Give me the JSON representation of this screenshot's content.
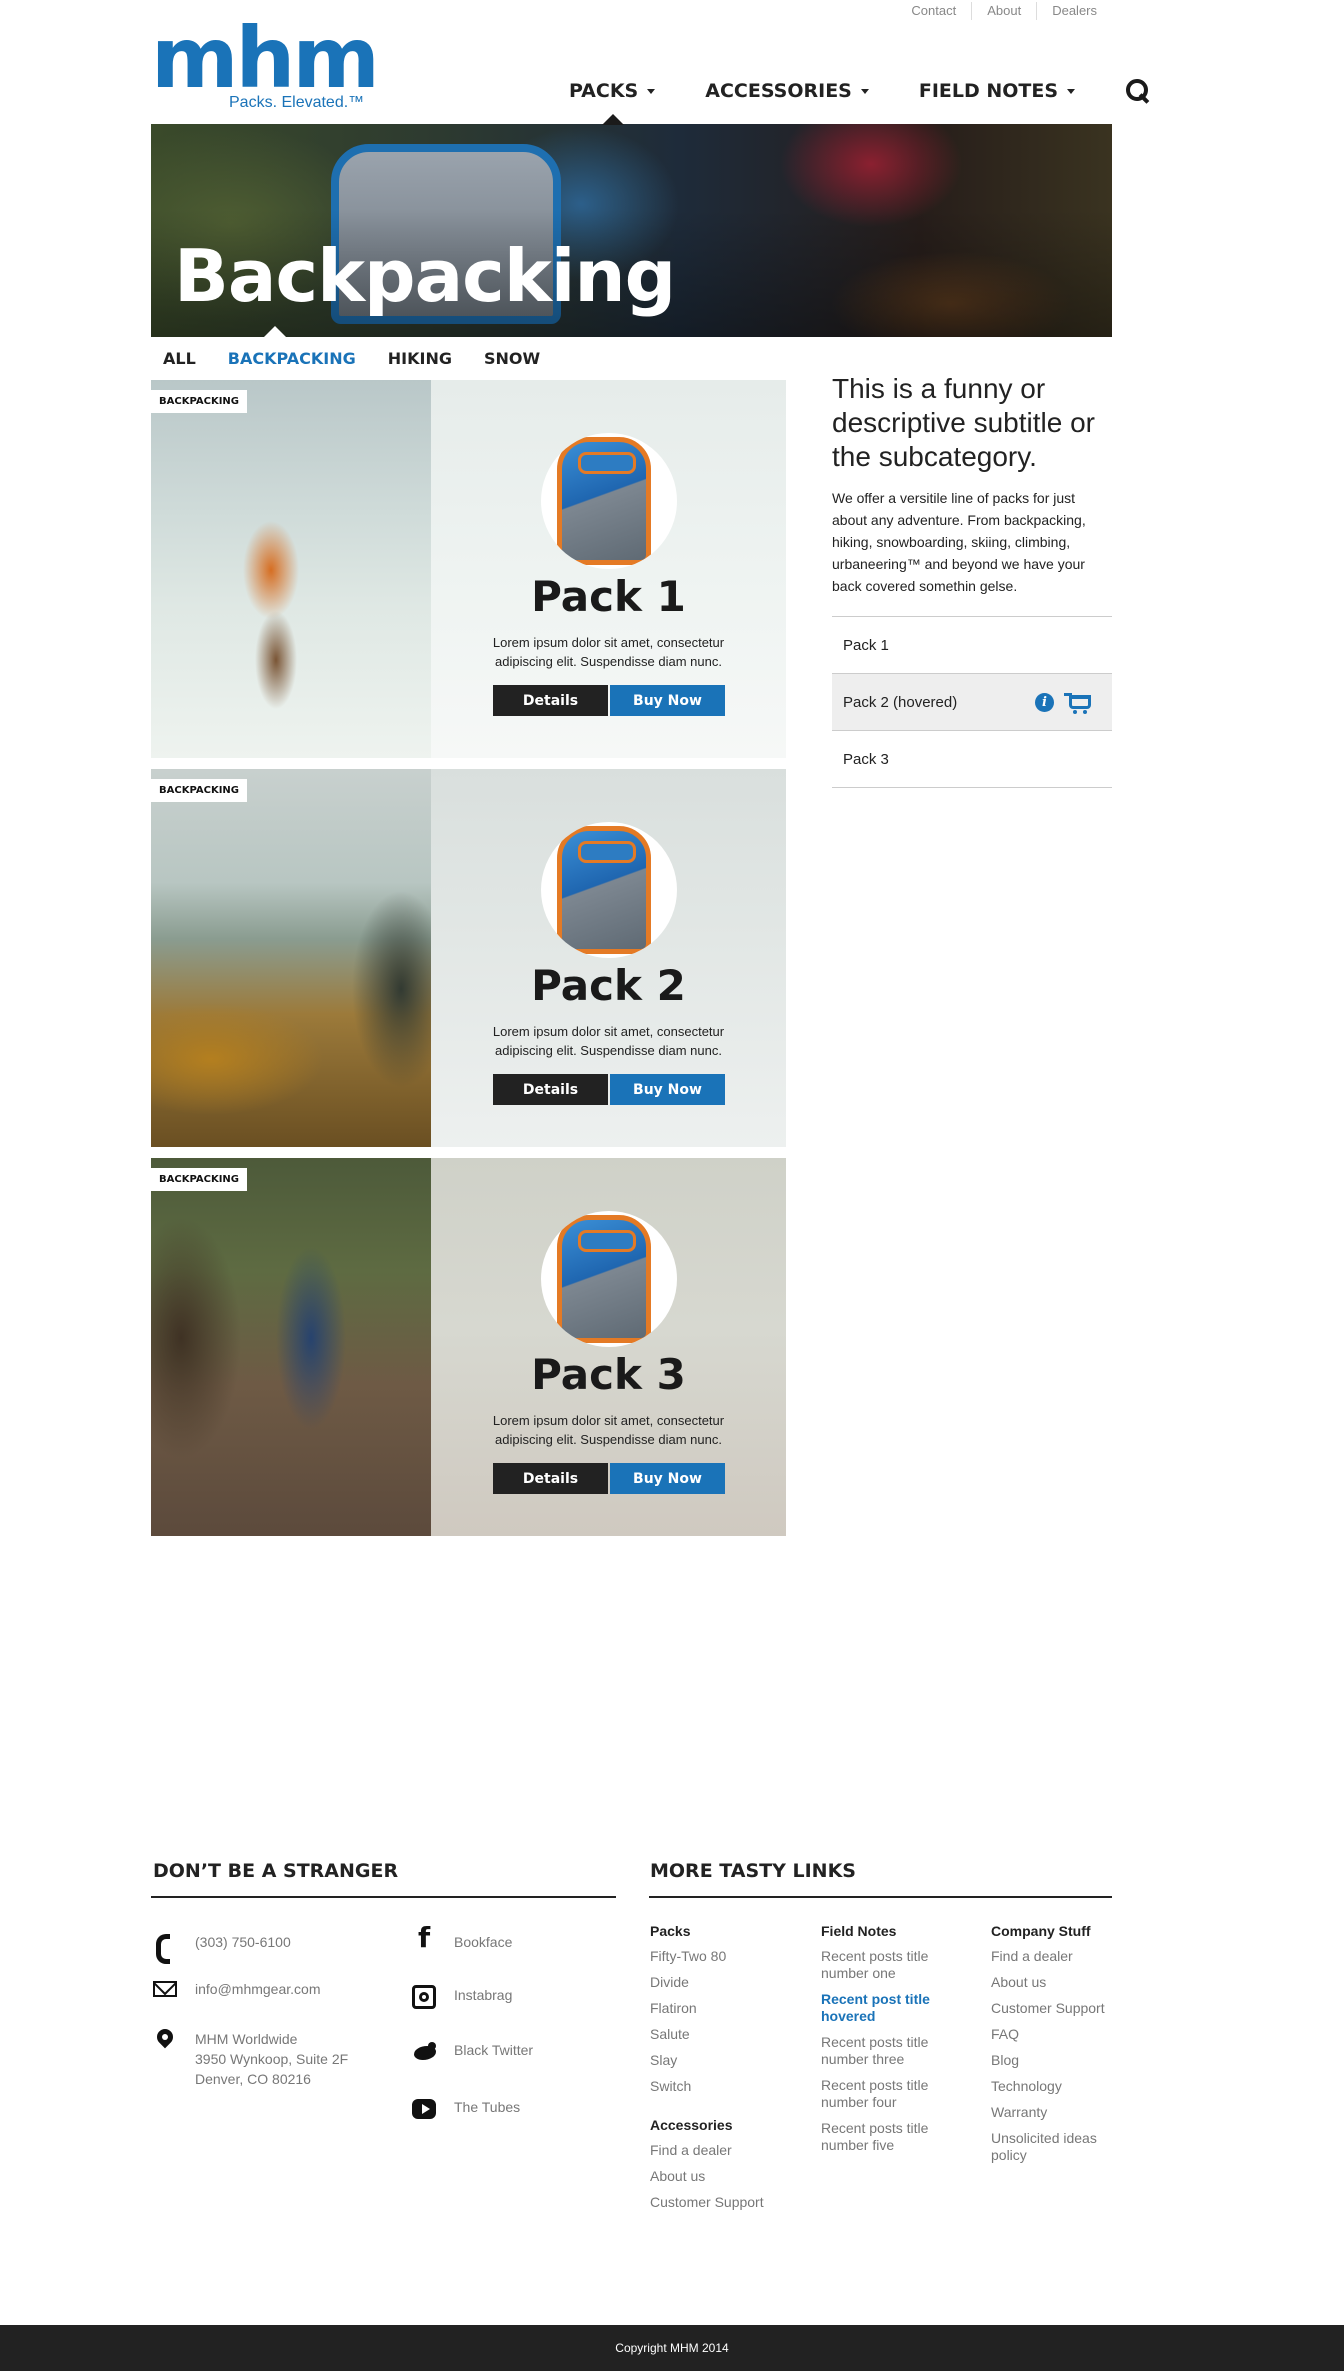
{
  "utility_nav": [
    "Contact",
    "About",
    "Dealers"
  ],
  "logo": {
    "wordmark": "mhm",
    "tagline": "Packs. Elevated.™"
  },
  "main_nav": {
    "items": [
      {
        "label": "PACKS",
        "active": true
      },
      {
        "label": "ACCESSORIES"
      },
      {
        "label": "FIELD NOTES"
      }
    ],
    "search_icon": "search-icon"
  },
  "hero": {
    "title": "Backpacking"
  },
  "subtabs": [
    {
      "label": "ALL"
    },
    {
      "label": "BACKPACKING",
      "active": true
    },
    {
      "label": "HIKING"
    },
    {
      "label": "SNOW"
    }
  ],
  "products": [
    {
      "badge": "BACKPACKING",
      "name": "Pack 1",
      "description": "Lorem ipsum dolor sit amet, consectetur adipiscing elit. Suspendisse diam nunc.",
      "details_label": "Details",
      "buy_label": "Buy Now"
    },
    {
      "badge": "BACKPACKING",
      "name": "Pack 2",
      "description": "Lorem ipsum dolor sit amet, consectetur adipiscing elit. Suspendisse diam nunc.",
      "details_label": "Details",
      "buy_label": "Buy Now"
    },
    {
      "badge": "BACKPACKING",
      "name": "Pack 3",
      "description": "Lorem ipsum dolor sit amet, consectetur adipiscing elit. Suspendisse diam nunc.",
      "details_label": "Details",
      "buy_label": "Buy Now"
    }
  ],
  "sidebar": {
    "subtitle": "This is a funny or descriptive subtitle or the subcategory.",
    "body": "We offer a versitile line of packs for just about any adventure. From backpacking, hiking, snowboarding, skiing, climbing, urbaneering™ and beyond we have your back covered somethin gelse.",
    "list": [
      {
        "label": "Pack 1"
      },
      {
        "label": "Pack 2 (hovered)",
        "hovered": true,
        "icons": [
          "info-icon",
          "cart-icon"
        ]
      },
      {
        "label": "Pack 3"
      }
    ]
  },
  "footer": {
    "contact_heading": "DON’T BE A STRANGER",
    "phone": "(303) 750-6100",
    "email": "info@mhmgear.com",
    "address": [
      "MHM Worldwide",
      "3950 Wynkoop, Suite 2F",
      "Denver, CO 80216"
    ],
    "social": [
      {
        "label": "Bookface",
        "icon": "facebook-icon"
      },
      {
        "label": "Instabrag",
        "icon": "instagram-icon"
      },
      {
        "label": "Black Twitter",
        "icon": "twitter-icon"
      },
      {
        "label": "The Tubes",
        "icon": "youtube-icon"
      }
    ],
    "links_heading": "MORE TASTY LINKS",
    "packs": {
      "heading": "Packs",
      "items": [
        "Fifty-Two 80",
        "Divide",
        "Flatiron",
        "Salute",
        "Slay",
        "Switch"
      ]
    },
    "accessories": {
      "heading": "Accessories",
      "items": [
        "Find a dealer",
        "About us",
        "Customer Support"
      ]
    },
    "field_notes": {
      "heading": "Field Notes",
      "items": [
        "Recent posts title number one",
        "Recent post title hovered",
        "Recent posts title number three",
        "Recent posts title number four",
        "Recent posts title number five"
      ]
    },
    "company": {
      "heading": "Company Stuff",
      "items": [
        "Find a dealer",
        "About us",
        "Customer Support",
        "FAQ",
        "Blog",
        "Technology",
        "Warranty",
        "Unsolicited ideas policy"
      ]
    },
    "copyright": "Copyright MHM 2014"
  },
  "colors": {
    "brand_blue": "#1a73b8",
    "dark": "#222222"
  }
}
